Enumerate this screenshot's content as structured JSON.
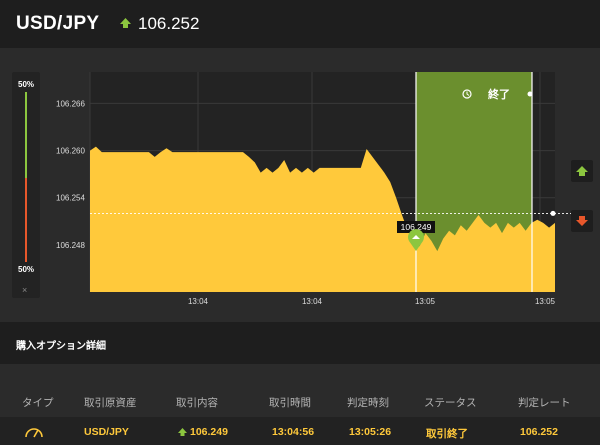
{
  "header": {
    "pair": "USD/JPY",
    "price": "106.252",
    "price_direction_icon": "up-arrow-icon",
    "up_color": "#8cc63f"
  },
  "meter": {
    "top_label": "50%",
    "bottom_label": "50%",
    "close_label": "×",
    "up_color": "#8cc63f",
    "down_color": "#e8572b"
  },
  "chart": {
    "y_ticks": [
      "106.266",
      "106.260",
      "106.254",
      "106.248"
    ],
    "x_ticks": [
      "13:04",
      "13:04",
      "13:05",
      "13:05"
    ],
    "entry_label": "106.249",
    "end_label": "終了",
    "clock_icon": "clock-icon",
    "chart_data": {
      "type": "area",
      "ylim": [
        106.242,
        106.27
      ],
      "y_tick_values": [
        106.266,
        106.26,
        106.254,
        106.248
      ],
      "x_tick_labels": [
        "13:04",
        "13:04",
        "13:05",
        "13:05"
      ],
      "series": [
        {
          "color": "#ffc93b",
          "values": [
            106.26,
            106.2605,
            106.2598,
            106.2598,
            106.2598,
            106.2598,
            106.2598,
            106.2598,
            106.2598,
            106.2598,
            106.2598,
            106.2592,
            106.2598,
            106.2603,
            106.2598,
            106.2598,
            106.2598,
            106.2598,
            106.2598,
            106.2598,
            106.2598,
            106.2598,
            106.2598,
            106.2598,
            106.2598,
            106.2598,
            106.2598,
            106.2592,
            106.2585,
            106.2572,
            106.2578,
            106.2572,
            106.2578,
            106.2588,
            106.2572,
            106.2578,
            106.2572,
            106.2578,
            106.2572,
            106.2578,
            106.2578,
            106.2578,
            106.2578,
            106.2578,
            106.2578,
            106.2578,
            106.2578,
            106.2602,
            106.2592,
            106.2582,
            106.2572,
            106.256,
            106.254,
            106.2518,
            106.2498,
            106.2492,
            106.2478,
            106.2495,
            106.2485,
            106.2472,
            106.2488,
            106.2498,
            106.2492,
            106.2505,
            106.2498,
            106.2508,
            106.2518,
            106.2508,
            106.2502,
            106.2508,
            106.2495,
            106.2508,
            106.2502,
            106.2508,
            106.2498,
            106.2508,
            106.2512,
            106.2508,
            106.2502,
            106.2508
          ]
        }
      ],
      "entry_value": 106.249,
      "current_value": 106.252
    }
  },
  "section": {
    "title": "購入オプション詳細"
  },
  "table": {
    "headers": [
      "タイプ",
      "取引原資産",
      "取引内容",
      "取引時間",
      "判定時刻",
      "ステータス",
      "判定レート"
    ],
    "row": {
      "type_icon": "gauge-icon",
      "asset": "USD/JPY",
      "content": "106.249",
      "content_icon": "up-arrow-icon",
      "trade_time": "13:04:56",
      "judge_time": "13:05:26",
      "status": "取引終了",
      "rate": "106.252"
    }
  }
}
